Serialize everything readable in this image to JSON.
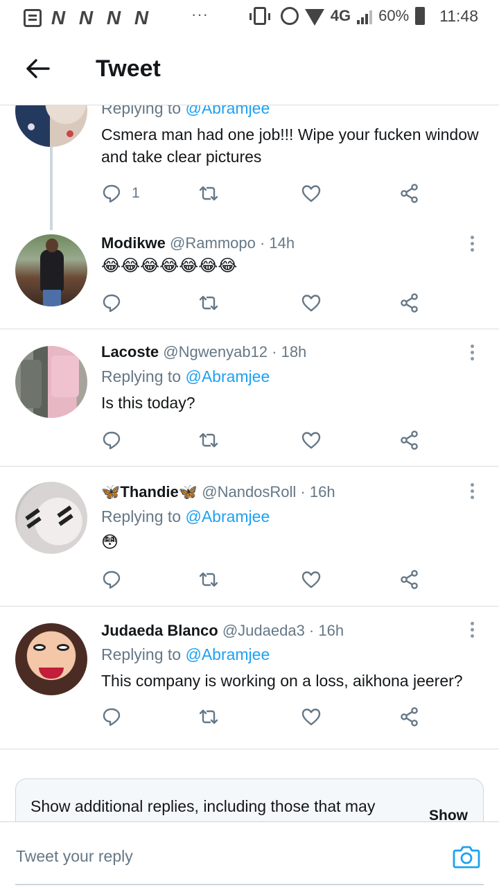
{
  "status_bar": {
    "carrier_marks": [
      "N",
      "N",
      "N",
      "N"
    ],
    "more": "···",
    "network": "4G",
    "battery": "60%",
    "time": "11:48"
  },
  "header": {
    "title": "Tweet"
  },
  "tweets": [
    {
      "replying_prefix": "Replying to ",
      "replying_to": "@Abramjee",
      "text": "Csmera man had one job!!! Wipe your fucken window and take clear pictures",
      "reply_count": "1"
    },
    {
      "name": "Modikwe",
      "handle": "@Rammopo · 14h",
      "text": "😂😂😂😂😂😂😂"
    },
    {
      "name": "Lacoste",
      "handle": "@Ngwenyab12 · 18h",
      "replying_prefix": "Replying to ",
      "replying_to": "@Abramjee",
      "text": "Is this today?"
    },
    {
      "name": "🦋Thandie🦋",
      "handle": "@NandosRoll · 16h",
      "replying_prefix": "Replying to ",
      "replying_to": "@Abramjee",
      "text": "😳"
    },
    {
      "name": "Judaeda Blanco",
      "handle": "@Judaeda3 · 16h",
      "replying_prefix": "Replying to ",
      "replying_to": "@Abramjee",
      "text": "This company is working on a loss, aikhona jeerer?"
    }
  ],
  "show_more": {
    "text": "Show additional replies, including those that may",
    "button": "Show"
  },
  "reply_bar": {
    "placeholder": "Tweet your reply"
  },
  "colors": {
    "link": "#1da1f2",
    "secondary": "#657786",
    "divider": "#d8dde1"
  }
}
